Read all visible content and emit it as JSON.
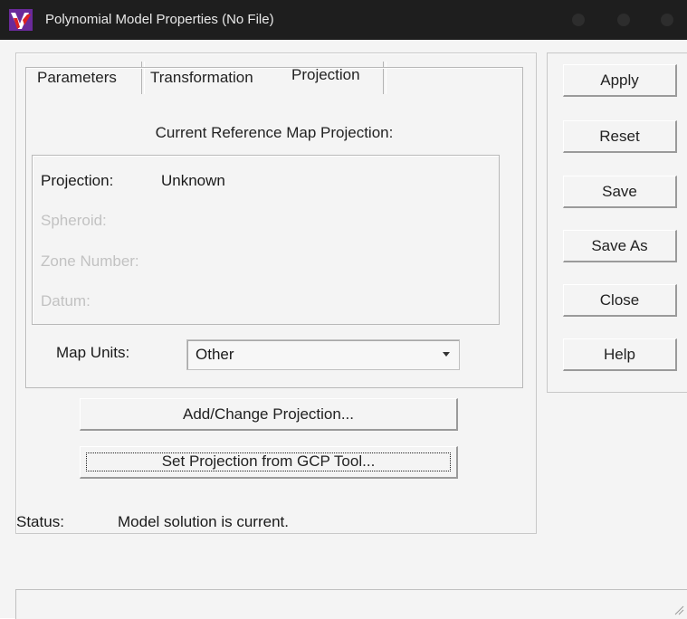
{
  "window": {
    "title": "Polynomial Model Properties (No File)",
    "icon": "erdas-app-icon"
  },
  "tabs": [
    {
      "label": "Parameters",
      "active": false
    },
    {
      "label": "Transformation",
      "active": false
    },
    {
      "label": "Projection",
      "active": true
    }
  ],
  "projection_group": {
    "title": "Current Reference Map Projection:",
    "fields": [
      {
        "label": "Projection:",
        "value": "Unknown",
        "enabled": true
      },
      {
        "label": "Spheroid:",
        "value": "",
        "enabled": false
      },
      {
        "label": "Zone Number:",
        "value": "",
        "enabled": false
      },
      {
        "label": "Datum:",
        "value": "",
        "enabled": false
      }
    ],
    "map_units": {
      "label": "Map Units:",
      "selected": "Other"
    }
  },
  "buttons": {
    "add_change_projection": "Add/Change Projection...",
    "set_projection_from_gcp": "Set Projection from GCP Tool..."
  },
  "side_buttons": [
    "Apply",
    "Reset",
    "Save",
    "Save As",
    "Close",
    "Help"
  ],
  "status": {
    "label": "Status:",
    "text": "Model solution is current."
  }
}
